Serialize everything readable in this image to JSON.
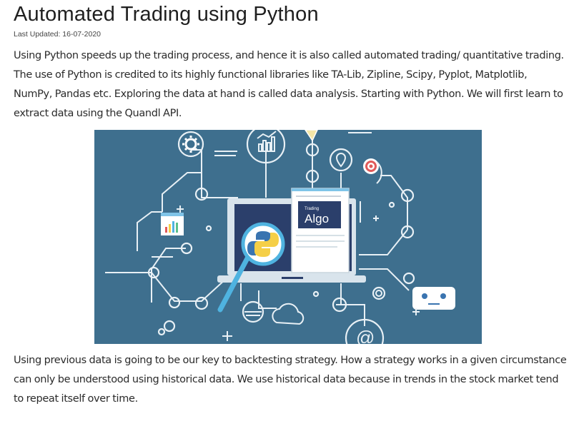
{
  "article": {
    "title": "Automated Trading using Python",
    "last_updated": "Last Updated: 16-07-2020",
    "paragraph_1": "Using Python speeds up the trading process, and hence it is also called automated trading/ quantitative trading. The use of Python is credited to its highly functional libraries like TA-Lib, Zipline, Scipy, Pyplot, Matplotlib, NumPy, Pandas etc. Exploring the data at hand is called data analysis.  Starting with Python. We will first learn to extract data using the Quandl API.",
    "paragraph_2": "Using previous data is going to be our key to backtesting strategy. How a strategy works in a given circumstance can only be understood using historical data. We use historical data because in trends in the stock market tend to repeat itself over time."
  },
  "illustration": {
    "card_small_text": "Trading",
    "card_big_text": "Algo",
    "email_symbol": "@",
    "colors": {
      "background": "#3e6f8e",
      "line": "#e8f0f5",
      "screen": "#2b3f6b",
      "python_blue": "#3a74b0",
      "python_yellow": "#f5cf47",
      "magnifier": "#4fb3e0",
      "target_red": "#e05a5a"
    }
  }
}
